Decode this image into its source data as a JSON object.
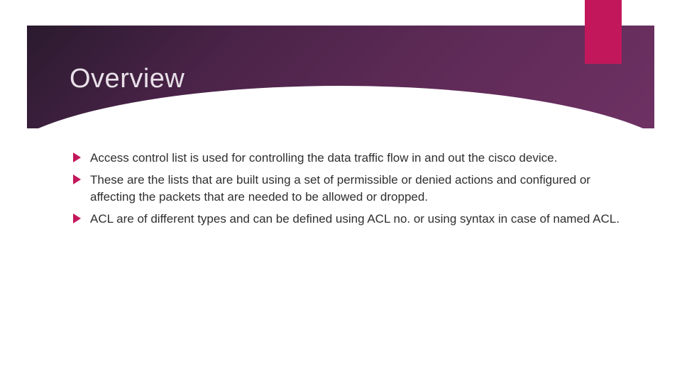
{
  "slide": {
    "title": "Overview",
    "bullets": [
      "Access control list is used for controlling the data traffic flow in and out the cisco device.",
      "These are the lists that are built using a set of permissible or denied actions and configured or affecting the packets that are needed to be allowed or dropped.",
      "ACL are of different types and can be defined using ACL no. or using syntax in case of named ACL."
    ]
  },
  "theme": {
    "accent_color": "#c2185b",
    "header_gradient_start": "#2a1a2e",
    "header_gradient_end": "#6e3163"
  }
}
